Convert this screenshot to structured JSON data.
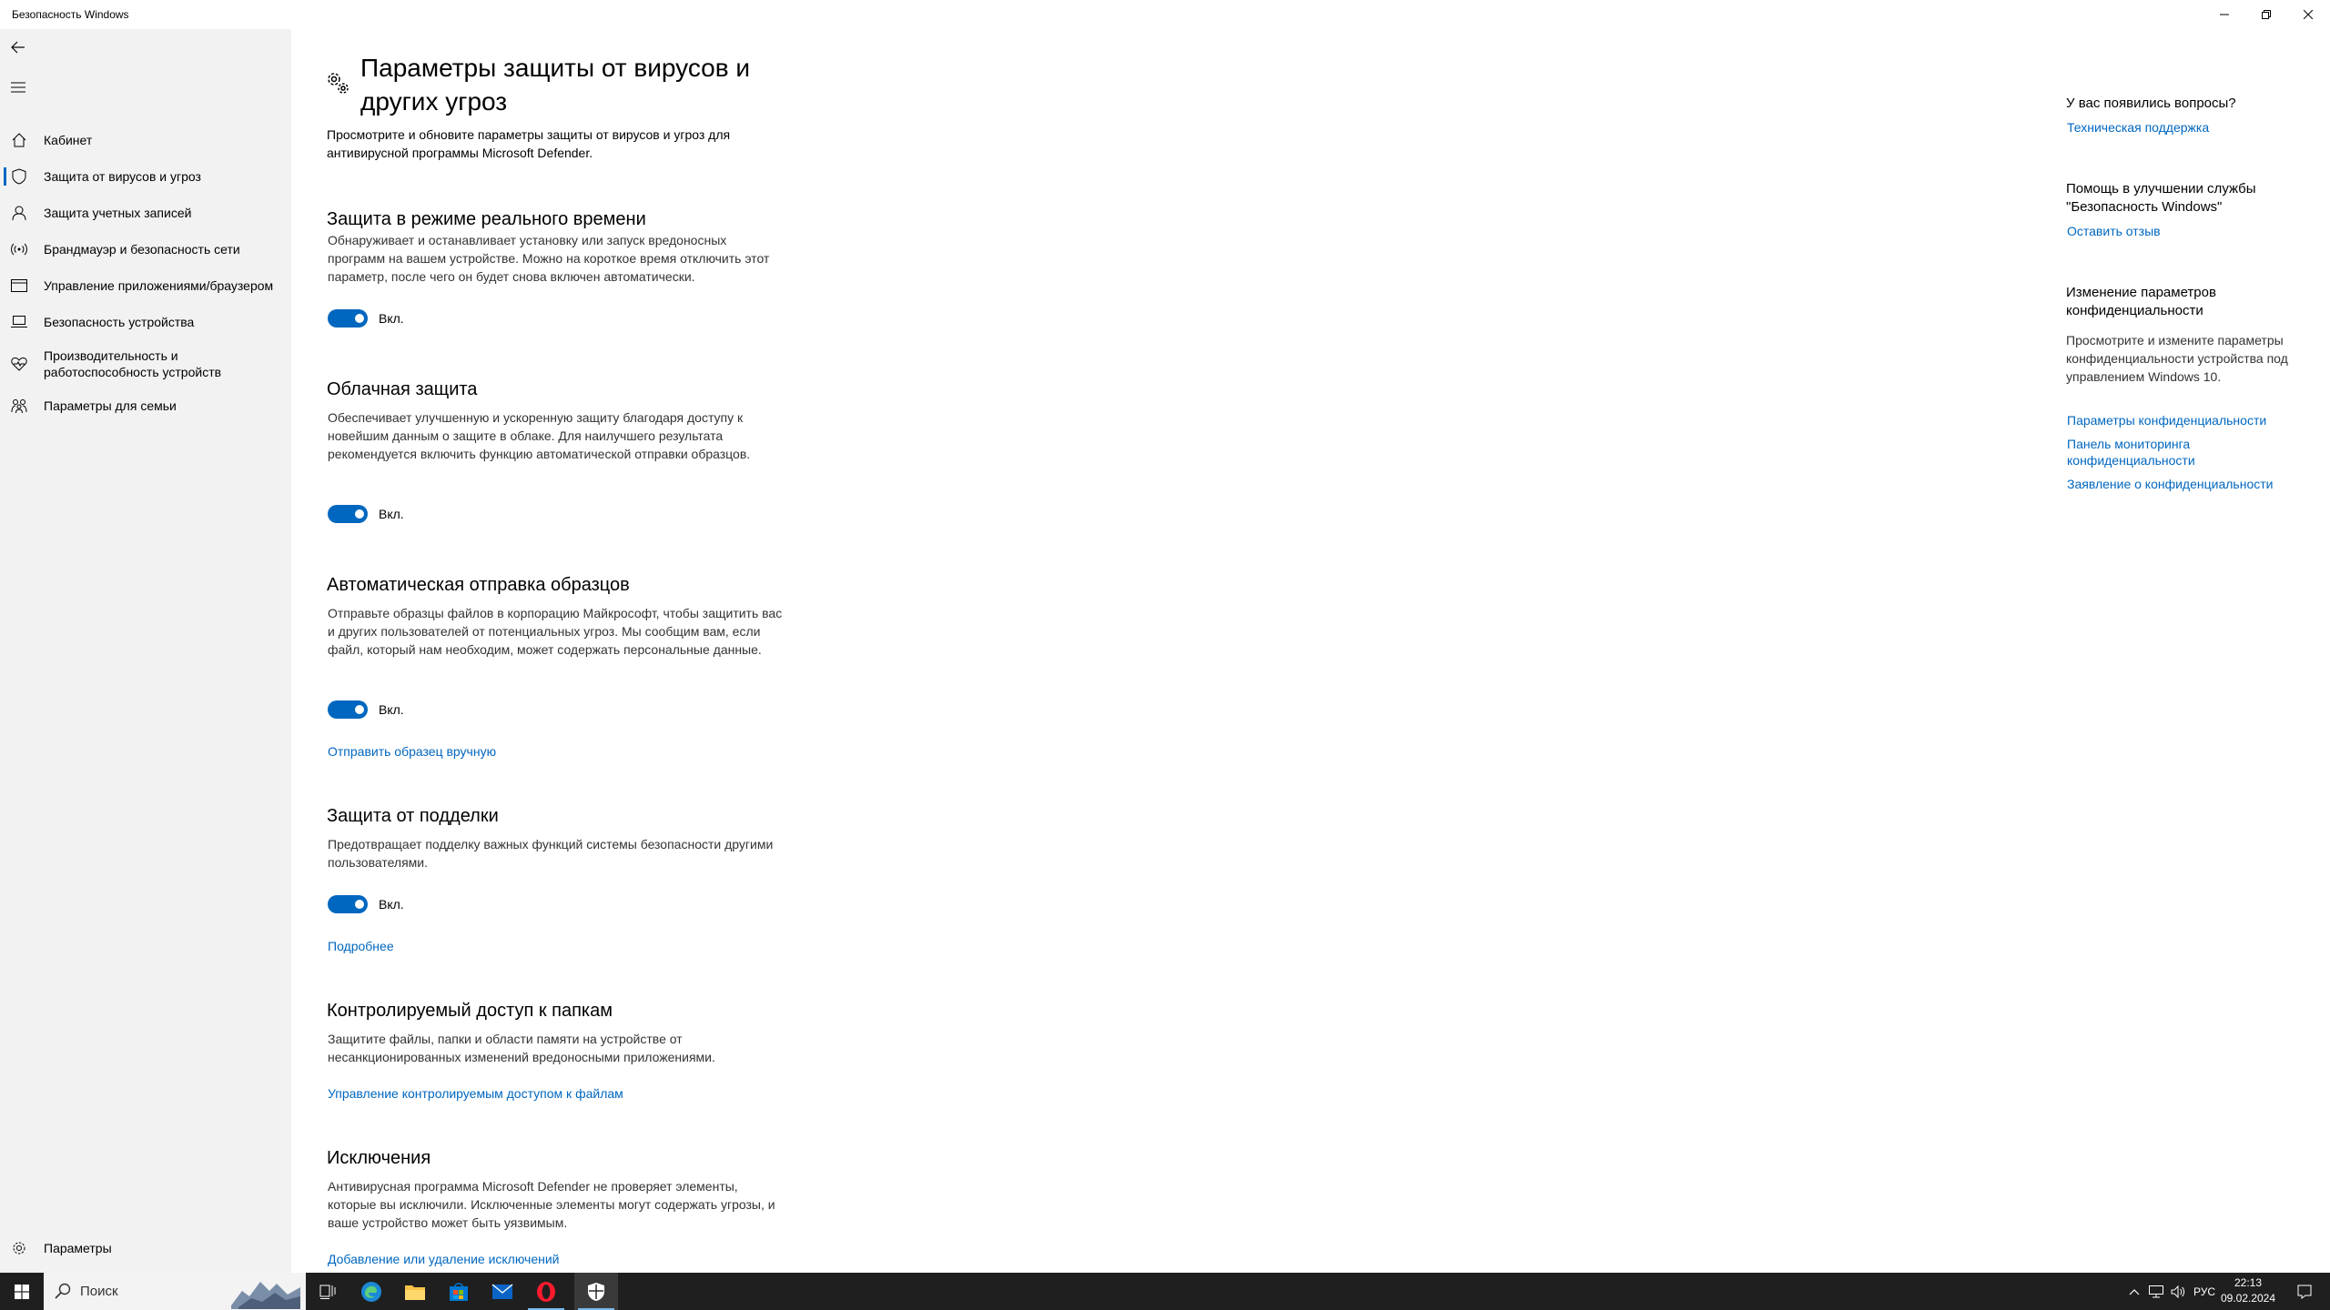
{
  "window": {
    "title": "Безопасность Windows"
  },
  "sidebar": {
    "items": [
      {
        "label": "Кабинет",
        "icon": "home-icon"
      },
      {
        "label": "Защита от вирусов и угроз",
        "icon": "shield-icon",
        "active": true
      },
      {
        "label": "Защита учетных записей",
        "icon": "person-icon"
      },
      {
        "label": "Брандмауэр и безопасность сети",
        "icon": "wifi-antenna-icon"
      },
      {
        "label": "Управление приложениями/браузером",
        "icon": "app-browser-icon"
      },
      {
        "label": "Безопасность устройства",
        "icon": "laptop-icon"
      },
      {
        "label": "Производительность и работоспособность устройств",
        "icon": "heart-icon"
      },
      {
        "label": "Параметры для семьи",
        "icon": "family-icon"
      }
    ],
    "settings_label": "Параметры"
  },
  "main": {
    "title": "Параметры защиты от вирусов и других угроз",
    "description": "Просмотрите и обновите параметры защиты от вирусов и угроз для антивирусной программы Microsoft Defender.",
    "sections": [
      {
        "title": "Защита в режиме реального времени",
        "description": "Обнаруживает и останавливает установку или запуск вредоносных программ на вашем устройстве. Можно на короткое время отключить этот параметр, после чего он будет снова включен автоматически.",
        "toggle_label": "Вкл."
      },
      {
        "title": "Облачная защита",
        "description": "Обеспечивает улучшенную и ускоренную защиту благодаря доступу к новейшим данным о защите в облаке. Для наилучшего результата рекомендуется включить функцию автоматической отправки образцов.",
        "toggle_label": "Вкл."
      },
      {
        "title": "Автоматическая отправка образцов",
        "description": "Отправьте образцы файлов в корпорацию Майкрософт, чтобы защитить вас и других пользователей от потенциальных угроз. Мы сообщим вам, если файл, который нам необходим, может содержать персональные данные.",
        "toggle_label": "Вкл.",
        "link": "Отправить образец вручную"
      },
      {
        "title": "Защита от подделки",
        "description": "Предотвращает подделку важных функций системы безопасности другими пользователями.",
        "toggle_label": "Вкл.",
        "link": "Подробнее"
      },
      {
        "title": "Контролируемый доступ к папкам",
        "description": "Защитите файлы, папки и области памяти на устройстве от несанкционированных изменений вредоносными приложениями.",
        "link": "Управление контролируемым доступом к файлам"
      },
      {
        "title": "Исключения",
        "description": "Антивирусная программа Microsoft Defender не проверяет элементы, которые вы исключили. Исключенные элементы могут содержать угрозы, и ваше устройство может быть уязвимым.",
        "link": "Добавление или удаление исключений"
      }
    ]
  },
  "right_pane": {
    "questions_title": "У вас появились вопросы?",
    "support_link": "Техническая поддержка",
    "improve_title": "Помощь в улучшении службы \"Безопасность Windows\"",
    "feedback_link": "Оставить отзыв",
    "privacy_title": "Изменение параметров конфиденциальности",
    "privacy_text": "Просмотрите и измените параметры конфиденциальности устройства под управлением Windows 10.",
    "privacy_settings_link": "Параметры конфиденциальности",
    "privacy_dashboard_link": "Панель мониторинга конфиденциальности",
    "privacy_statement_link": "Заявление о конфиденциальности"
  },
  "taskbar": {
    "search_placeholder": "Поиск",
    "apps": [
      "task-view-icon",
      "edge-icon",
      "file-explorer-icon",
      "store-icon",
      "mail-icon",
      "opera-icon",
      "windows-security-icon"
    ],
    "language": "РУС",
    "time": "22:13",
    "date": "09.02.2024",
    "toggle_color": "#0067c0",
    "link_color": "#0067c0"
  }
}
